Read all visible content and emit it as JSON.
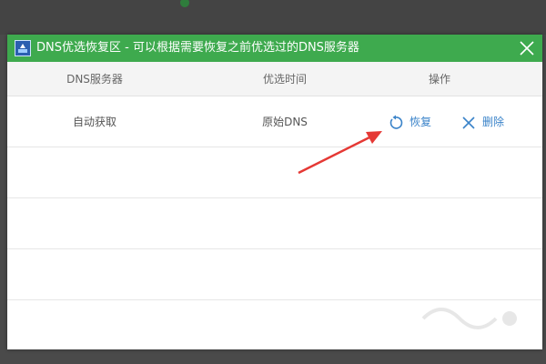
{
  "dialog": {
    "title": "DNS优选恢复区 - 可以根据需要恢复之前优选过的DNS服务器"
  },
  "table": {
    "headers": [
      "DNS服务器",
      "优选时间",
      "操作"
    ],
    "rows": [
      {
        "server": "自动获取",
        "time": "原始DNS",
        "actions": {
          "restore": "恢复",
          "delete": "删除"
        }
      }
    ]
  },
  "colors": {
    "titlebar": "#3eaa4e",
    "action": "#3a83c9",
    "arrow": "#e53935"
  },
  "icons": {
    "app": "dns-app-icon",
    "close": "close-icon",
    "restore": "restore-icon",
    "delete": "delete-icon"
  }
}
